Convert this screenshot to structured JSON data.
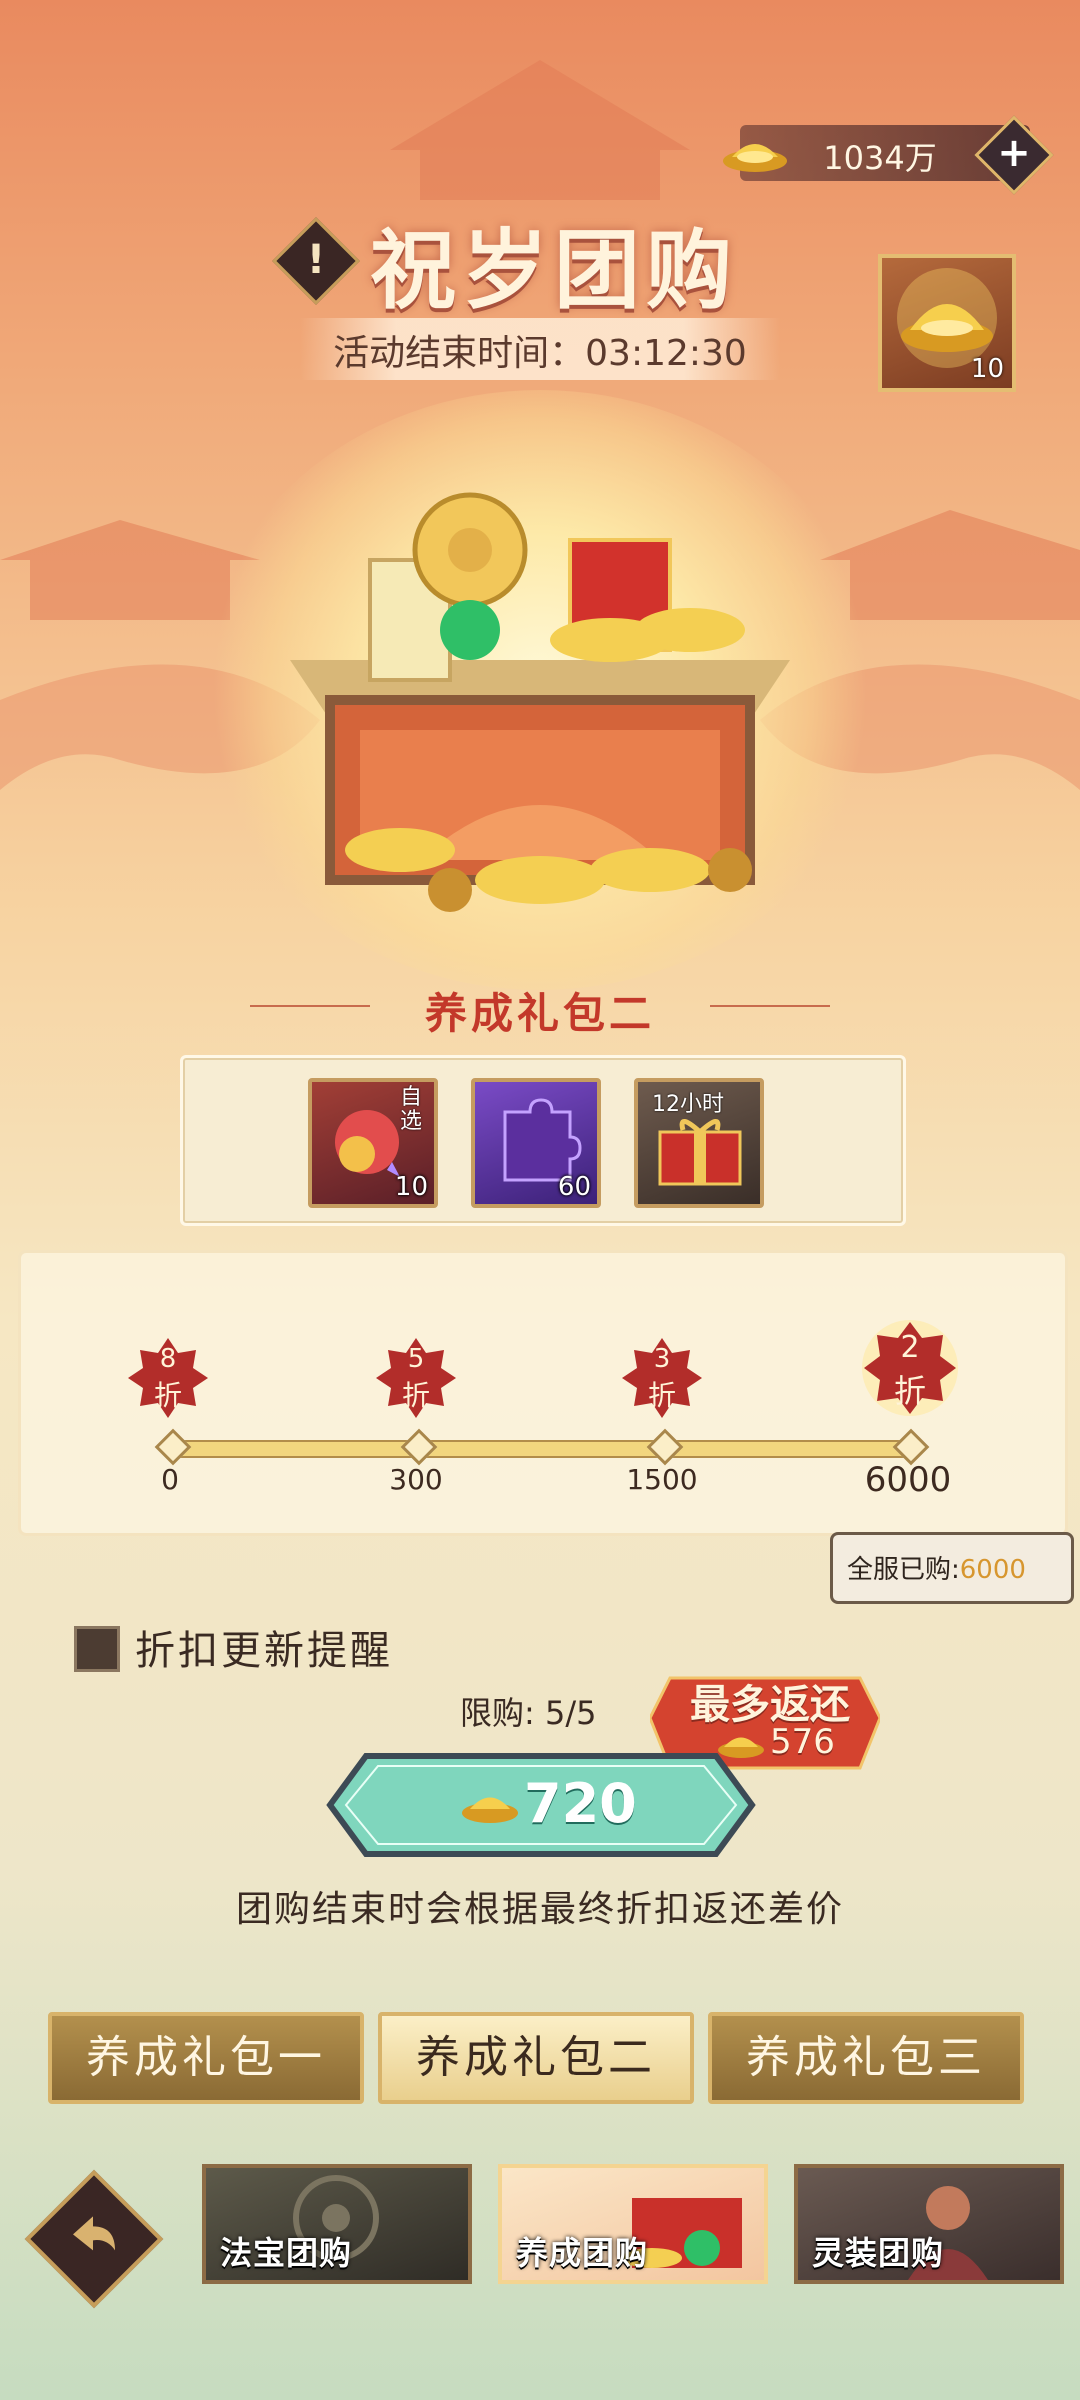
{
  "currency": {
    "amount": "1034万",
    "plus": "+"
  },
  "header": {
    "title": "祝岁团购",
    "info": "!",
    "timer": "活动结束时间：03:12:30"
  },
  "reward_box": {
    "count": "10"
  },
  "gift": {
    "title": "养成礼包二",
    "items": [
      {
        "count": "10",
        "tag": "自选"
      },
      {
        "count": "60",
        "tag": ""
      },
      {
        "count": "",
        "tag": "12小时"
      }
    ]
  },
  "discount": {
    "tiers": [
      {
        "num": "8",
        "unit": "折",
        "threshold": "0"
      },
      {
        "num": "5",
        "unit": "折",
        "threshold": "300"
      },
      {
        "num": "3",
        "unit": "折",
        "threshold": "1500"
      },
      {
        "num": "2",
        "unit": "折",
        "threshold": "6000"
      }
    ],
    "server_bought_label": "全服已购:",
    "server_bought_value": "6000"
  },
  "reminder": {
    "label": "折扣更新提醒"
  },
  "purchase": {
    "limit": "限购: 5/5",
    "max_return_label": "最多返还",
    "max_return_value": "576",
    "price": "720",
    "note": "团购结束时会根据最终折扣返还差价"
  },
  "tabs": [
    "养成礼包一",
    "养成礼包二",
    "养成礼包三"
  ],
  "active_tab": 1,
  "nav": [
    "法宝团购",
    "养成团购",
    "灵装团购"
  ],
  "active_nav": 1,
  "colors": {
    "accent_red": "#c3382a",
    "gold": "#e4bd72",
    "teal_button": "#7fd6bd",
    "gold_value": "#d7962e"
  }
}
